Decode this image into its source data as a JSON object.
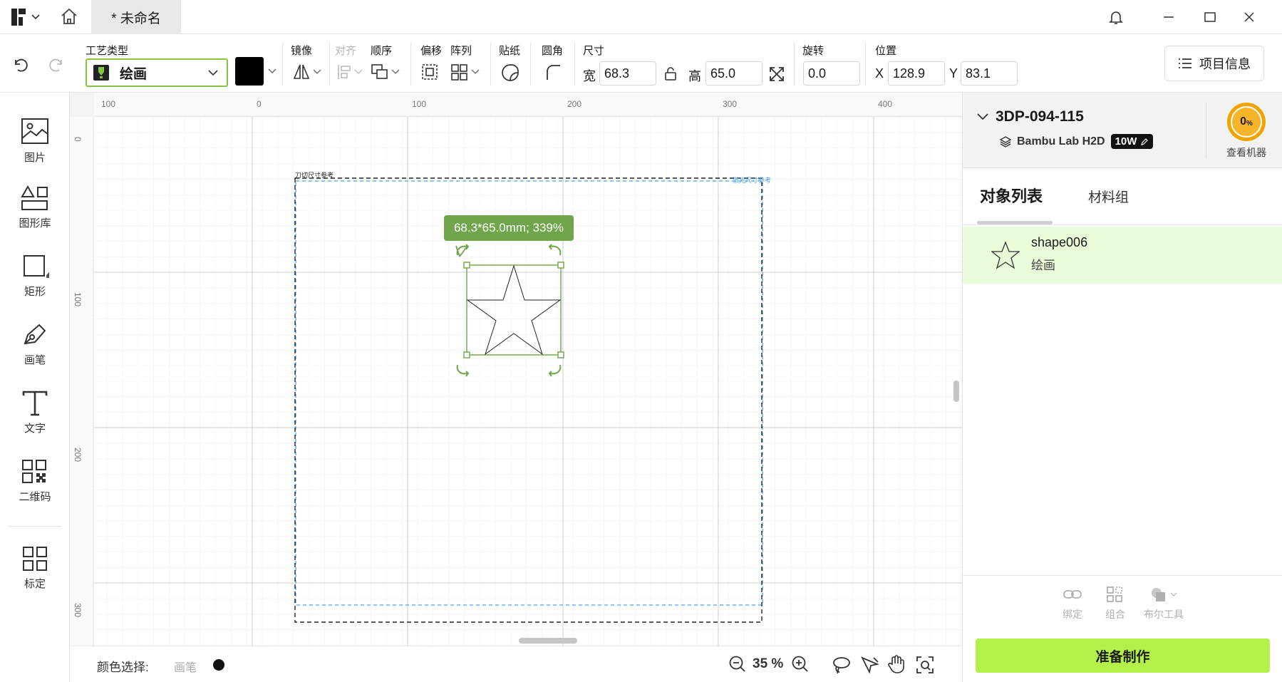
{
  "titlebar": {
    "tab_title": "* 未命名"
  },
  "toolbar": {
    "process_type_label": "工艺类型",
    "process_type_value": "绘画",
    "mirror_label": "镜像",
    "align_label": "对齐",
    "order_label": "顺序",
    "offset_label": "偏移",
    "array_label": "阵列",
    "sticker_label": "贴纸",
    "corner_label": "圆角",
    "size_label": "尺寸",
    "width_label": "宽",
    "width_value": "68.3",
    "height_label": "高",
    "height_value": "65.0",
    "rotation_label": "旋转",
    "rotation_value": "0.0",
    "position_label": "位置",
    "x_label": "X",
    "x_value": "128.9",
    "y_label": "Y",
    "y_value": "83.1",
    "project_info": "项目信息",
    "color_swatch": "#000000"
  },
  "left_tools": [
    {
      "label": "图片",
      "icon": "image-icon"
    },
    {
      "label": "图形库",
      "icon": "shape-library-icon"
    },
    {
      "label": "矩形",
      "icon": "rectangle-icon"
    },
    {
      "label": "画笔",
      "icon": "pen-icon"
    },
    {
      "label": "文字",
      "icon": "text-icon"
    },
    {
      "label": "二维码",
      "icon": "qrcode-icon"
    },
    {
      "label": "标定",
      "icon": "calibrate-icon"
    }
  ],
  "canvas": {
    "h_ruler": [
      "100",
      "0",
      "100",
      "200",
      "300",
      "400"
    ],
    "v_ruler": [
      "0",
      "100",
      "200",
      "300"
    ],
    "knife_ref_label": "刀切尺寸参考",
    "laser_ref_label": "激光尺寸参考",
    "size_tooltip": "68.3*65.0mm; 339%"
  },
  "bottom_bar": {
    "color_select_label": "颜色选择:",
    "pen_label": "画笔",
    "zoom": "35 %"
  },
  "right_panel": {
    "device_name": "3DP-094-115",
    "printer_model": "Bambu Lab H2D",
    "laser_power": "10W",
    "progress_text": "0",
    "progress_unit": "%",
    "view_machine": "查看机器",
    "tab_objects": "对象列表",
    "tab_materials": "材料组",
    "object_name": "shape006",
    "object_type": "绘画",
    "bind_label": "绑定",
    "group_label": "组合",
    "boolean_label": "布尔工具",
    "prepare_button": "准备制作"
  },
  "colors": {
    "accent": "#84c441",
    "selection": "#6fa64b",
    "prepare_bg": "#b4f04a",
    "object_row_bg": "#eafbd9",
    "laser_guide": "#4aa3f0",
    "progress_ring": "#f0a400"
  }
}
